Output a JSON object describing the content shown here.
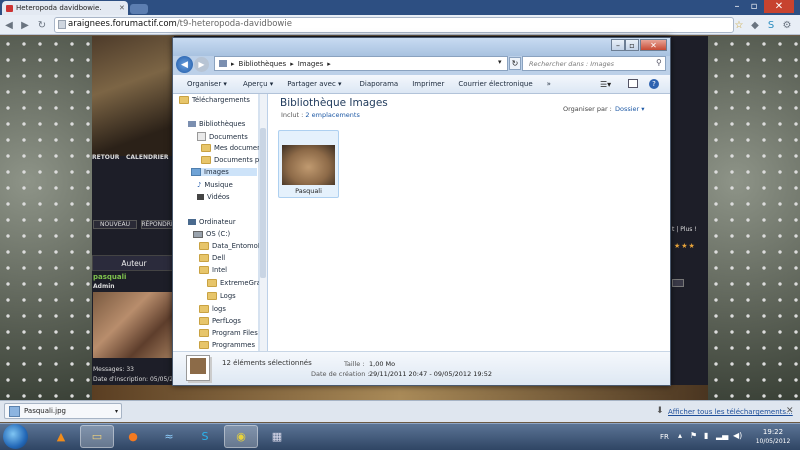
{
  "browser": {
    "tab_title": "Heteropoda davidbowie.",
    "url_host": "araignees.forumactif.com",
    "url_path": "/t9-heteropoda-davidbowie"
  },
  "website": {
    "nav_left": "RETOUR",
    "nav_right": "CALENDRIER",
    "btn1": "NOUVEAU",
    "btn2": "RÉPONDRE",
    "post_header": "Auteur",
    "author_name": "pasquali",
    "author_role": "Admin",
    "author_messages": "Messages: 33",
    "author_since": "Date d'inscription: 05/05/201",
    "right_links": "t | Plus !",
    "stars": "★★★"
  },
  "explorer": {
    "breadcrumb_1": "Bibliothèques",
    "breadcrumb_2": "Images",
    "search_placeholder": "Rechercher dans : Images",
    "toolbar": {
      "organize": "Organiser ▾",
      "preview": "Aperçu ▾",
      "share": "Partager avec ▾",
      "slideshow": "Diaporama",
      "print": "Imprimer",
      "email": "Courrier électronique",
      "more": "»"
    },
    "nav": {
      "downloads": "Téléchargements",
      "libraries": "Bibliothèques",
      "documents": "Documents",
      "my_documents": "Mes document",
      "public_documents": "Documents pu",
      "images": "Images",
      "music": "Musique",
      "videos": "Vidéos",
      "computer": "Ordinateur",
      "os_drive": "OS (C:)",
      "folders": [
        "Data_EntomoD",
        "Dell",
        "Intel",
        "ExtremeGrapl",
        "Logs",
        "logs",
        "PerfLogs",
        "Program Files (",
        "Programmes"
      ]
    },
    "library_title": "Bibliothèque Images",
    "includes_label": "Inclut :",
    "includes_link": "2 emplacements",
    "arrange_label": "Organiser par :",
    "arrange_value": "Dossier ▾",
    "file_name": "Pasquali",
    "details": {
      "count": "12 éléments sélectionnés",
      "size_label": "Taille :",
      "size": "1,00 Mo",
      "date_label": "Date de création :",
      "date": "29/11/2011 20:47 - 09/05/2012 19:52"
    }
  },
  "download_bar": {
    "file": "Pasquali.jpg",
    "show_all": "Afficher tous les téléchargements..."
  },
  "taskbar": {
    "lang": "FR",
    "time": "19:22",
    "date": "10/05/2012"
  }
}
